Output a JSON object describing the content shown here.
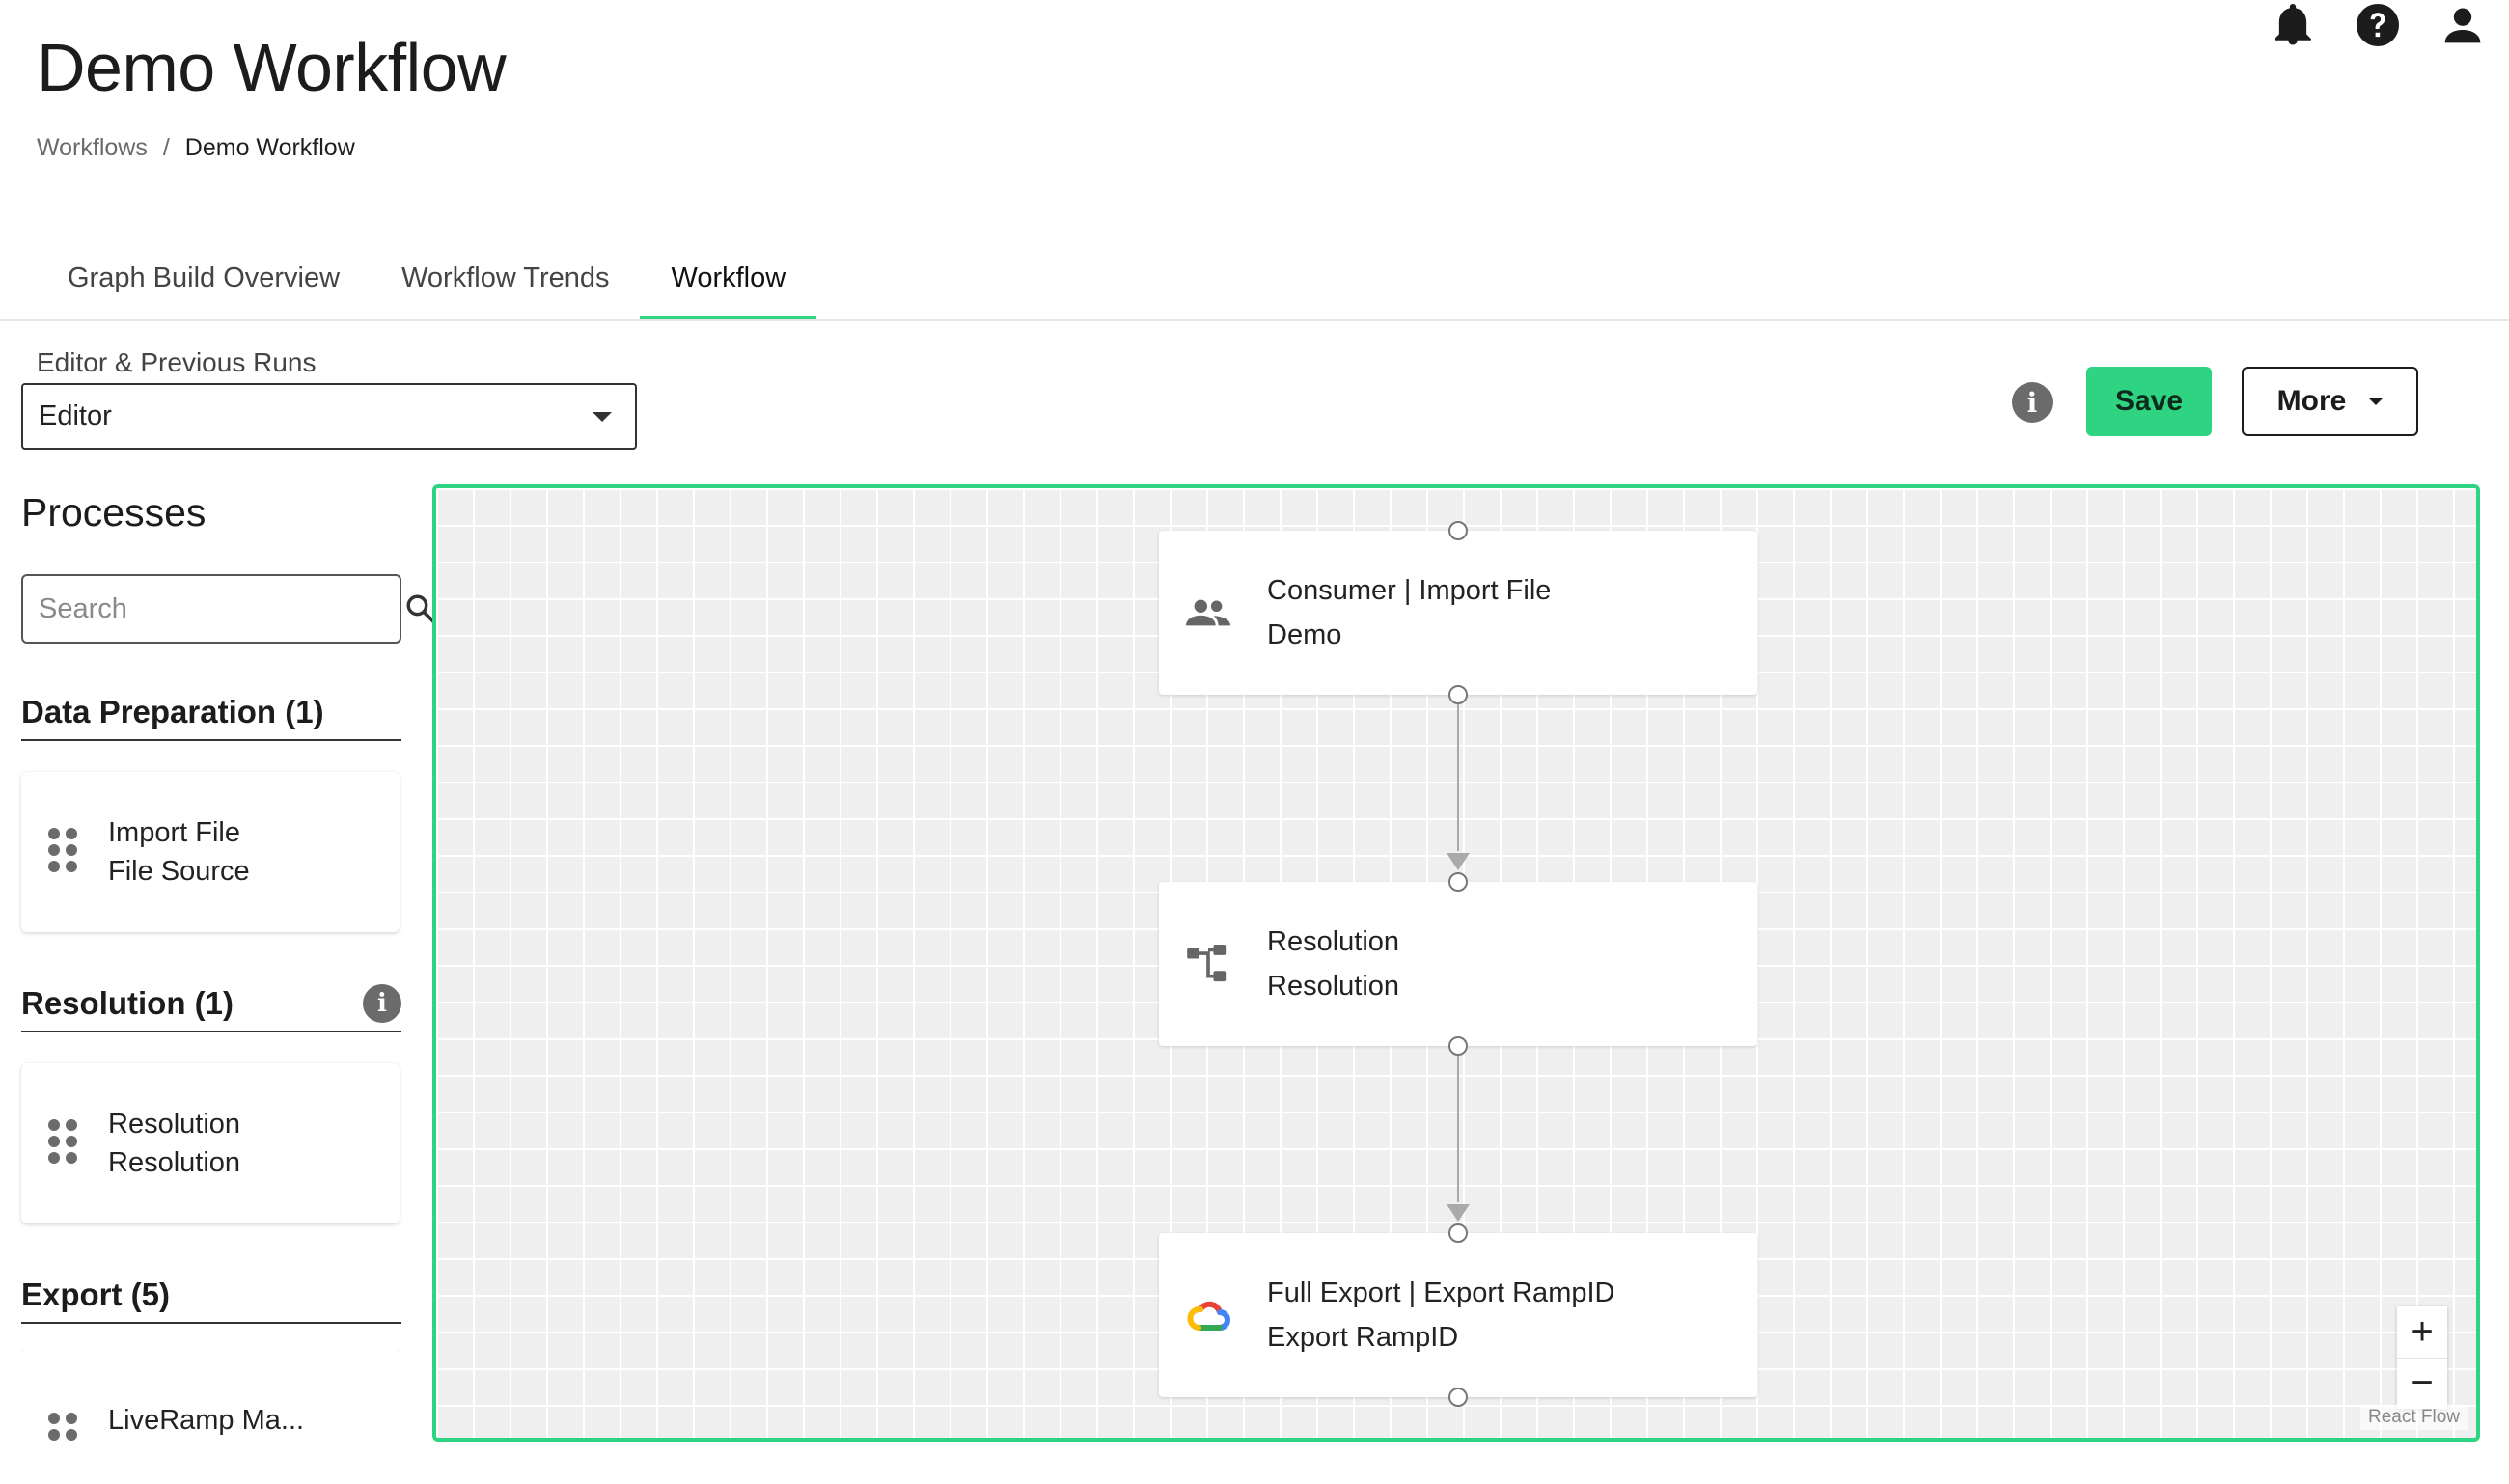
{
  "header": {
    "title": "Demo Workflow",
    "breadcrumb": {
      "parent": "Workflows",
      "separator": "/",
      "current": "Demo Workflow"
    },
    "icons": [
      "bell-icon",
      "help-icon",
      "account-icon"
    ]
  },
  "tabs": [
    {
      "label": "Graph Build Overview",
      "active": false
    },
    {
      "label": "Workflow Trends",
      "active": false
    },
    {
      "label": "Workflow",
      "active": true
    }
  ],
  "runs": {
    "label": "Editor & Previous Runs",
    "selected": "Editor"
  },
  "actions": {
    "save_label": "Save",
    "more_label": "More"
  },
  "processes": {
    "title": "Processes",
    "search_placeholder": "Search",
    "sections": [
      {
        "title": "Data Preparation (1)",
        "items": [
          {
            "line1": "Import File",
            "line2": "File Source"
          }
        ]
      },
      {
        "title": "Resolution (1)",
        "items": [
          {
            "line1": "Resolution",
            "line2": "Resolution"
          }
        ]
      },
      {
        "title": "Export (5)",
        "items": [
          {
            "line1": "LiveRamp Ma...",
            "line2": ""
          }
        ]
      }
    ]
  },
  "canvas": {
    "nodes": [
      {
        "title": "Consumer | Import File",
        "subtitle": "Demo",
        "icon": "people-icon"
      },
      {
        "title": "Resolution",
        "subtitle": "Resolution",
        "icon": "resolution-icon"
      },
      {
        "title": "Full Export | Export RampID",
        "subtitle": "Export RampID",
        "icon": "google-cloud-icon"
      }
    ],
    "zoom_in": "+",
    "zoom_out": "−",
    "attribution": "React Flow"
  },
  "colors": {
    "accent": "#2fd483",
    "canvas_bg": "#efefef",
    "icon_gray": "#6b6b6b"
  }
}
